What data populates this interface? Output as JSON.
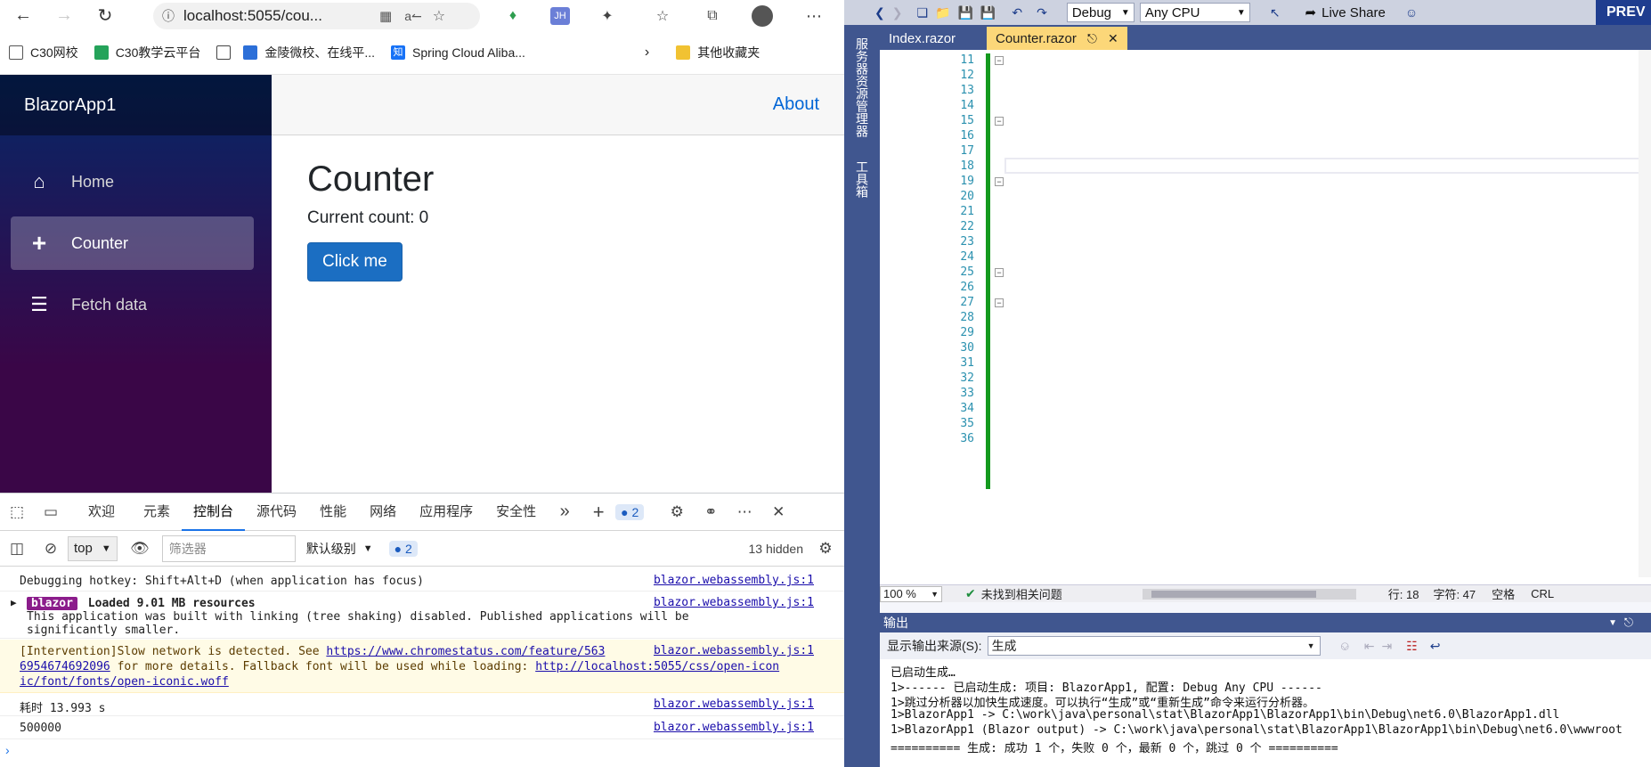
{
  "browser": {
    "url": "localhost:5055/cou...",
    "bookmarks": [
      {
        "label": "C30网校"
      },
      {
        "label": "C30教学云平台"
      },
      {
        "label": "金陵微校、在线平..."
      },
      {
        "label": "Spring Cloud Aliba..."
      },
      {
        "label": "其他收藏夹"
      }
    ]
  },
  "app": {
    "brand": "BlazorApp1",
    "about": "About",
    "nav": [
      {
        "label": "Home"
      },
      {
        "label": "Counter"
      },
      {
        "label": "Fetch data"
      }
    ],
    "title": "Counter",
    "current_count": "Current count: 0",
    "button": "Click me"
  },
  "devtools": {
    "tabs": [
      "欢迎",
      "元素",
      "控制台",
      "源代码",
      "性能",
      "网络",
      "应用程序",
      "安全性"
    ],
    "issues_badge": "2",
    "context": "top",
    "filter_placeholder": "筛选器",
    "level": "默认级别",
    "level_badge": "2",
    "hidden": "13 hidden",
    "logs": [
      {
        "text": "Debugging hotkey: Shift+Alt+D (when application has focus)",
        "src": "blazor.webassembly.js:1"
      },
      {
        "tag": "blazor",
        "text": "Loaded 9.01 MB resources",
        "text2": "This application was built with linking (tree shaking) disabled. Published applications will be",
        "text3": "significantly smaller.",
        "src": "blazor.webassembly.js:1"
      },
      {
        "pre": "[Intervention]Slow network is detected. See ",
        "link1": "https://www.chromestatus.com/feature/563",
        "line2_link": "6954674692096",
        "line2": " for more details. Fallback font will be used while loading: ",
        "link2": "http://localhost:5055/css/open-icon",
        "line3_link": "ic/font/fonts/open-iconic.woff",
        "src": "blazor.webassembly.js:1"
      },
      {
        "text": "耗时 13.993 s",
        "src": "blazor.webassembly.js:1"
      },
      {
        "text": "500000",
        "src": "blazor.webassembly.js:1"
      }
    ]
  },
  "vs": {
    "config": "Debug",
    "platform": "Any CPU",
    "live_share": "Live Share",
    "preview": "PREV",
    "side_labels": [
      "服务器资源管理器",
      "工具箱"
    ],
    "tabs": [
      {
        "label": "Index.razor"
      },
      {
        "label": "Counter.razor"
      }
    ],
    "line_numbers": [
      "11",
      "12",
      "13",
      "14",
      "15",
      "16",
      "17",
      "18",
      "19",
      "20",
      "21",
      "22",
      "23",
      "24",
      "25",
      "26",
      "27",
      "28",
      "29",
      "30",
      "31",
      "32",
      "33",
      "34",
      "35",
      "36"
    ],
    "status": {
      "zoom": "100 %",
      "issues": "未找到相关问题",
      "row": "行: 18",
      "col": "字符: 47",
      "space": "空格",
      "crlf": "CRL"
    },
    "output": {
      "title": "输出",
      "source_label": "显示输出来源(S):",
      "source_value": "生成",
      "lines": [
        "已启动生成…",
        "1>------ 已启动生成: 项目: BlazorApp1, 配置: Debug Any CPU ------",
        "1>跳过分析器以加快生成速度。可以执行“生成”或“重新生成”命令来运行分析器。",
        "1>BlazorApp1 -> C:\\work\\java\\personal\\stat\\BlazorApp1\\BlazorApp1\\bin\\Debug\\net6.0\\BlazorApp1.dll",
        "1>BlazorApp1 (Blazor output) -> C:\\work\\java\\personal\\stat\\BlazorApp1\\BlazorApp1\\bin\\Debug\\net6.0\\wwwroot",
        "========== 生成: 成功 1 个，失败 0 个，最新 0 个，跳过 0 个 =========="
      ]
    }
  }
}
